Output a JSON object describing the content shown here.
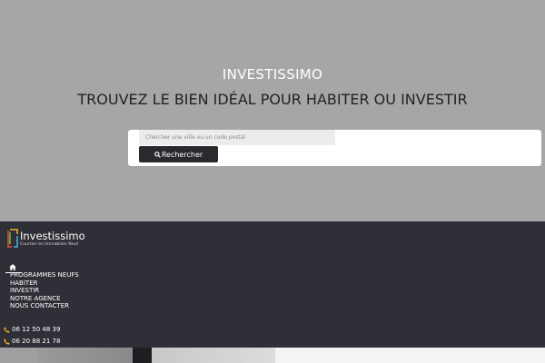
{
  "hero": {
    "brand": "INVESTISSIMO",
    "tagline": "TROUVEZ LE BIEN IDÉAL POUR HABITER OU INVESTIR"
  },
  "search": {
    "placeholder": "Chercher une ville ou un code postal",
    "button_label": "Rechercher",
    "button_icon": "search-icon"
  },
  "logo": {
    "name": "Investissimo",
    "subtitle": "Courtier en Immobilier Neuf"
  },
  "nav": {
    "home_icon": "home-icon",
    "items": [
      {
        "label": "PROGRAMMES NEUFS"
      },
      {
        "label": "HABITER"
      },
      {
        "label": "INVESTIR"
      },
      {
        "label": "NOTRE AGENCE"
      },
      {
        "label": "NOUS CONTACTER"
      }
    ]
  },
  "contact": {
    "phone_icon": "phone-icon",
    "phones": [
      "06 12 50 48 39",
      "06 20 88 21 78"
    ]
  },
  "colors": {
    "hero_bg": "#a6a6a6",
    "nav_bg": "#2f3037",
    "button_bg": "#2a2a2e",
    "phone_icon": "#f0a030"
  }
}
